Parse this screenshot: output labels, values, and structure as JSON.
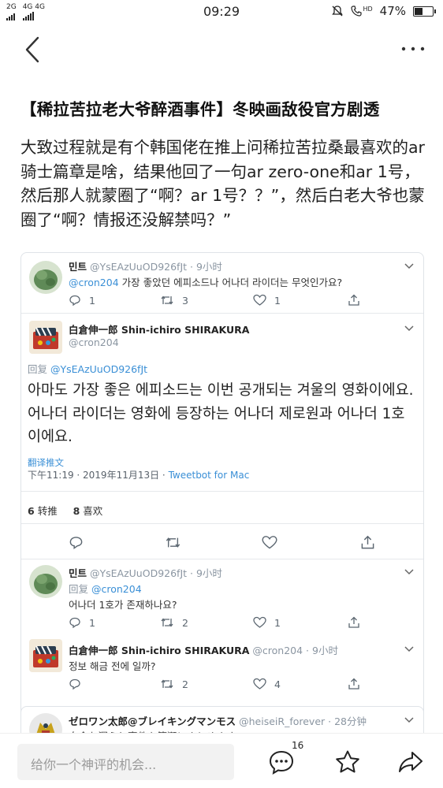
{
  "status_bar": {
    "sim1": "2G",
    "sim2": "4G 4G",
    "time": "09:29",
    "hd": "HD",
    "battery": "47%",
    "battery_level": 0.47
  },
  "article": {
    "headline": "【稀拉苦拉老大爷醉酒事件】冬映画敌役官方剧透",
    "body": "大致过程就是有个韩国佬在推上问稀拉苦拉桑最喜欢的ar骑士篇章是啥，结果他回了一句ar zero-one和ar 1号，然后那人就蒙圈了“啊？ar 1号？？”，然后白老大爷也蒙圈了“啊？情报还没解禁吗？”"
  },
  "tweets": {
    "t1": {
      "name": "민트",
      "handle": "@YsEAzUuOD926fJt · 9小时",
      "mention": "@cron204",
      "text": " 가장 좋았던 에피소드나 어나더 라이더는 무엇인가요?",
      "replies": "1",
      "retweets": "3",
      "likes": "1"
    },
    "main": {
      "name": "白倉伸一郎 Shin-ichiro SHIRAKURA",
      "handle": "@cron204",
      "reply_label": "回复",
      "reply_to": "@YsEAzUuOD926fJt",
      "text": "아마도 가장 좋은 에피소드는 이번 공개되는 겨울의 영화이에요. 어나더 라이더는 영화에 등장하는 어나더 제로원과 어나더 1호이에요.",
      "translate": "翻译推文",
      "timestamp": "下午11:19 · 2019年11月13日 · ",
      "client": "Tweetbot for Mac",
      "retweets_count": "6",
      "retweets_label": "转推",
      "likes_count": "8",
      "likes_label": "喜欢"
    },
    "t2": {
      "name": "민트",
      "handle": "@YsEAzUuOD926fJt · 9小时",
      "reply_label": "回复",
      "reply_to": "@cron204",
      "text": "어나더 1호가 존재하나요?",
      "replies": "1",
      "retweets": "2",
      "likes": "1"
    },
    "t3": {
      "name": "白倉伸一郎 Shin-ichiro SHIRAKURA",
      "handle": "@cron204 · 9小时",
      "text": "정보 해금 전에 일까?",
      "retweets": "2",
      "likes": "4"
    },
    "t4": {
      "name": "ゼロワン太郎@ブレイキングマンモス",
      "handle": "@heiseiR_forever · 28分钟",
      "text": "白倉お漏らし事件を簡潔にまとめます"
    }
  },
  "bottom_bar": {
    "comment_placeholder": "给你一个神评的机会...",
    "comment_count": "16"
  },
  "icons": {
    "back": "back-arrow-icon",
    "more": "more-icon",
    "reply": "reply-icon",
    "retweet": "retweet-icon",
    "like": "heart-icon",
    "share": "share-icon",
    "comment": "comment-icon",
    "favorite": "star-icon",
    "forward": "forward-icon"
  },
  "colors": {
    "link_blue": "#3a8fd6",
    "meta_gray": "#8a95a1"
  }
}
